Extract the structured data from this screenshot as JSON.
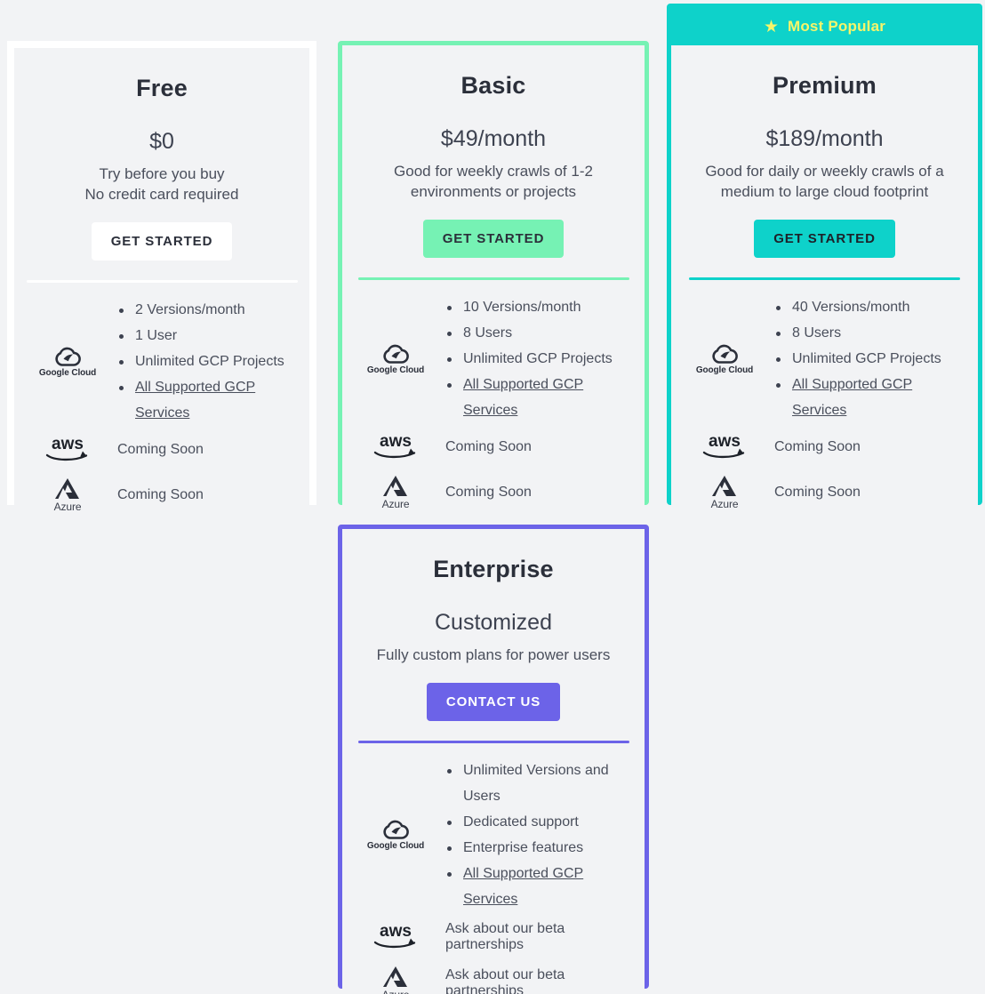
{
  "colors": {
    "page_bg": "#f2f3f5",
    "card_bg": "#f2f3f5",
    "free_accent": "#ffffff",
    "basic_accent": "#76f2b4",
    "premium_accent": "#0ed2ca",
    "enterprise_accent": "#6c63e8",
    "banner_text": "#f7f56a",
    "body_text": "#4a4f5c"
  },
  "banner": {
    "star_icon": "star-icon",
    "label": "Most Popular"
  },
  "providers": {
    "gcp_label": "Google Cloud",
    "aws_label": "aws",
    "azure_label": "Azure"
  },
  "plans": {
    "free": {
      "name": "Free",
      "price": "$0",
      "description": "Try before you buy\nNo credit card required",
      "desc_line1": "Try before you buy",
      "desc_line2": "No credit card required",
      "cta": "GET STARTED",
      "gcp_features": [
        "2 Versions/month",
        "1 User",
        "Unlimited GCP Projects",
        "All Supported GCP Services"
      ],
      "aws_status": "Coming Soon",
      "azure_status": "Coming Soon"
    },
    "basic": {
      "name": "Basic",
      "price": "$49/month",
      "desc_line1": "Good for weekly crawls of 1-2",
      "desc_line2": "environments or projects",
      "cta": "GET STARTED",
      "gcp_features": [
        "10 Versions/month",
        "8 Users",
        "Unlimited GCP Projects",
        "All Supported GCP Services"
      ],
      "aws_status": "Coming Soon",
      "azure_status": "Coming Soon"
    },
    "premium": {
      "name": "Premium",
      "price": "$189/month",
      "desc_line1": "Good for daily or weekly crawls of a",
      "desc_line2": "medium to large cloud footprint",
      "cta": "GET STARTED",
      "gcp_features": [
        "40 Versions/month",
        "8 Users",
        "Unlimited GCP Projects",
        "All Supported GCP Services"
      ],
      "aws_status": "Coming Soon",
      "azure_status": "Coming Soon"
    },
    "enterprise": {
      "name": "Enterprise",
      "price": "Customized",
      "desc_line1": "Fully custom plans for power users",
      "desc_line2": "",
      "cta": "CONTACT US",
      "gcp_features": [
        "Unlimited Versions and Users",
        "Dedicated support",
        "Enterprise features",
        "All Supported GCP Services"
      ],
      "aws_status": "Ask about our beta partnerships",
      "azure_status": "Ask about our beta partnerships"
    }
  }
}
